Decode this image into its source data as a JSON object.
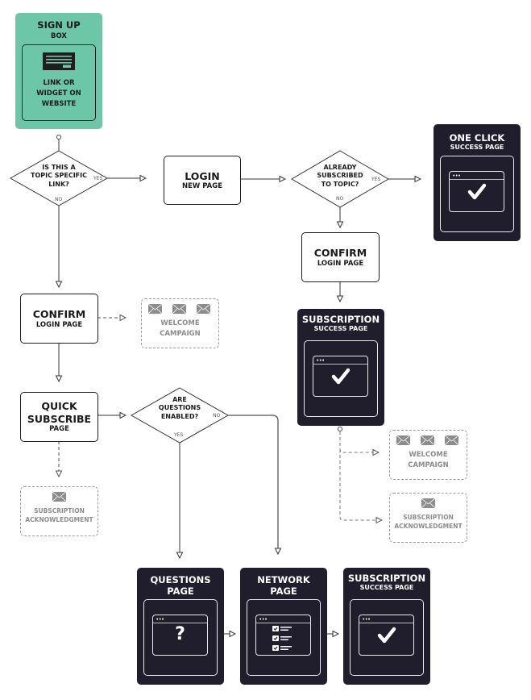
{
  "colors": {
    "signup_bg": "#6cc7a8",
    "dark_card": "#201d2c",
    "line": "#333333",
    "muted": "#8c8c8c"
  },
  "signup": {
    "title": "SIGN UP",
    "subtitle": "BOX",
    "icon": "widget-icon",
    "inner_lines": [
      "LINK OR",
      "WIDGET ON",
      "WEBSITE"
    ]
  },
  "decisions": {
    "topic_link": {
      "lines": [
        "IS THIS A",
        "TOPIC SPECIFIC",
        "LINK?"
      ],
      "yes": "YES",
      "no": "NO"
    },
    "already_subscribed": {
      "lines": [
        "ALREADY",
        "SUBSCRIBED",
        "TO TOPIC?"
      ],
      "yes": "YES",
      "no": "NO"
    },
    "questions_enabled": {
      "lines": [
        "ARE",
        "QUESTIONS",
        "ENABLED?"
      ],
      "yes": "YES",
      "no": "NO"
    }
  },
  "boxes": {
    "login": {
      "title": "LOGIN",
      "subtitle": "NEW PAGE"
    },
    "confirm_left": {
      "title": "CONFIRM",
      "subtitle": "LOGIN PAGE"
    },
    "confirm_right": {
      "title": "CONFIRM",
      "subtitle": "LOGIN PAGE"
    },
    "quick_subscribe": {
      "title_lines": [
        "QUICK",
        "SUBSCRIBE"
      ],
      "subtitle": "PAGE"
    }
  },
  "cards": {
    "one_click": {
      "title": "ONE CLICK",
      "subtitle": "SUCCESS PAGE",
      "icon": "checkmark-icon"
    },
    "subscription_right": {
      "title": "SUBSCRIPTION",
      "subtitle": "SUCCESS PAGE",
      "icon": "checkmark-icon"
    },
    "questions": {
      "title": "QUESTIONS",
      "subtitle": "PAGE",
      "icon": "question-mark-icon",
      "glyph": "?"
    },
    "network": {
      "title": "NETWORK",
      "subtitle": "PAGE",
      "icon": "checklist-icon"
    },
    "subscription_bottom": {
      "title": "SUBSCRIPTION",
      "subtitle": "SUCCESS PAGE",
      "icon": "checkmark-icon"
    }
  },
  "emails": {
    "welcome_left": {
      "lines": [
        "WELCOME",
        "CAMPAIGN"
      ],
      "envelopes": 3
    },
    "welcome_right": {
      "lines": [
        "WELCOME",
        "CAMPAIGN"
      ],
      "envelopes": 3
    },
    "ack_left": {
      "lines": [
        "SUBSCRIPTION",
        "ACKNOWLEDGMENT"
      ],
      "envelopes": 1
    },
    "ack_right": {
      "lines": [
        "SUBSCRIPTION",
        "ACKNOWLEDGMENT"
      ],
      "envelopes": 1
    }
  }
}
